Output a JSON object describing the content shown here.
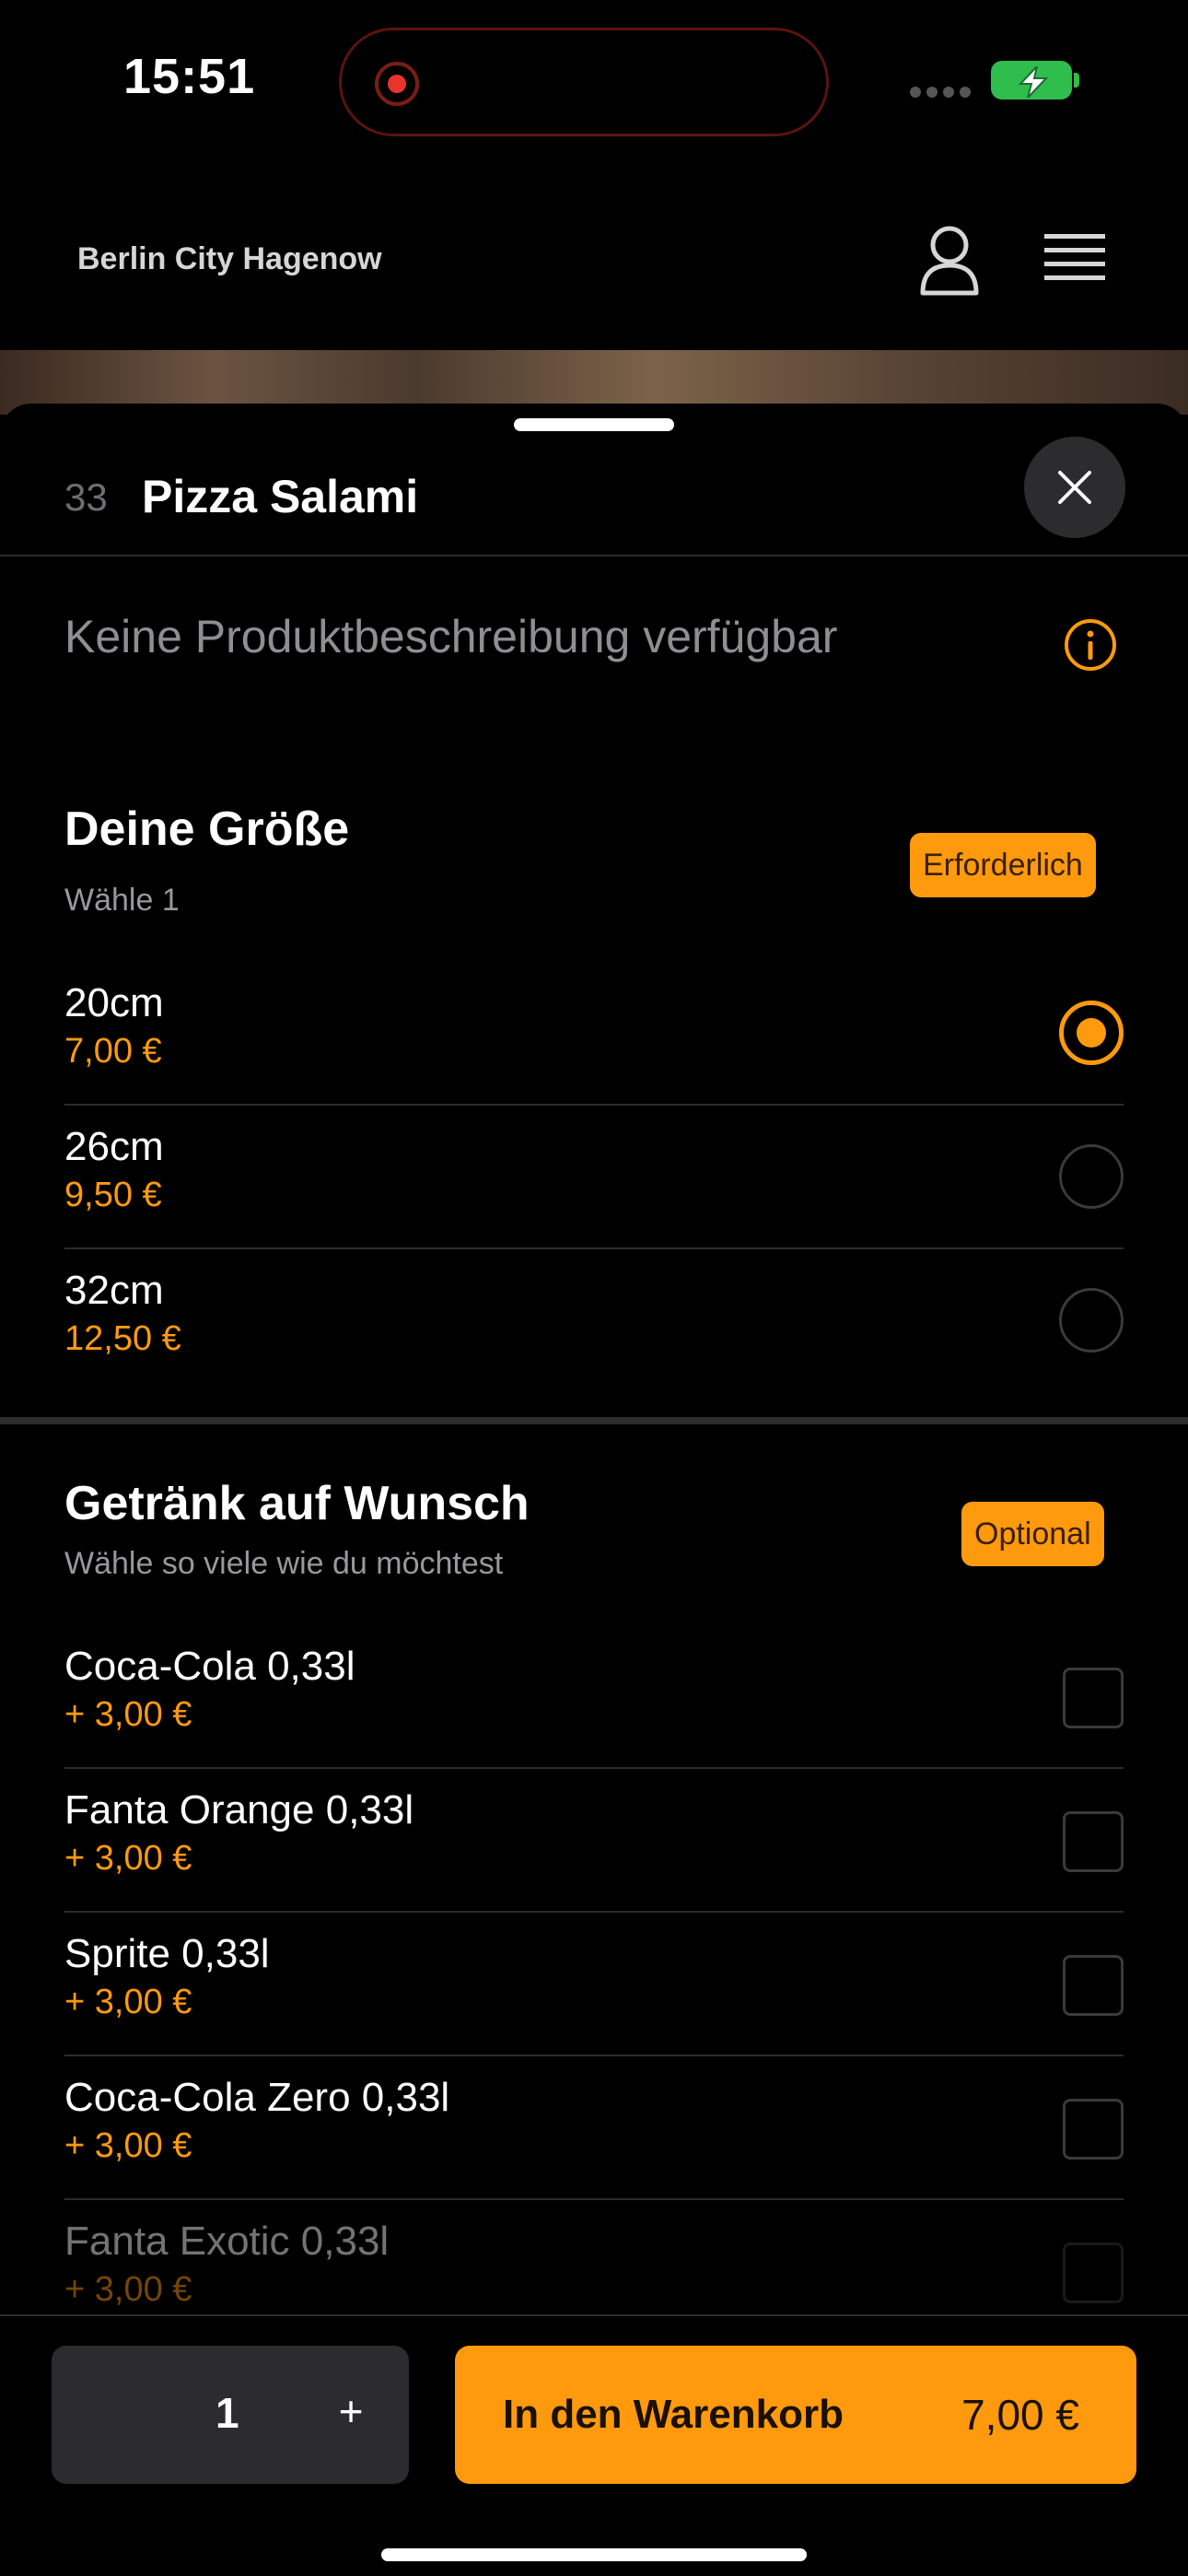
{
  "status_bar": {
    "time": "15:51"
  },
  "header": {
    "restaurant_name": "Berlin City Hagenow"
  },
  "product": {
    "number": "33",
    "title": "Pizza Salami",
    "description": "Keine Produktbeschreibung verfügbar"
  },
  "size_group": {
    "title": "Deine Größe",
    "subtitle": "Wähle 1",
    "badge": "Erforderlich",
    "options": [
      {
        "name": "20cm",
        "price": "7,00 €",
        "selected": true
      },
      {
        "name": "26cm",
        "price": "9,50 €",
        "selected": false
      },
      {
        "name": "32cm",
        "price": "12,50 €",
        "selected": false
      }
    ]
  },
  "drink_group": {
    "title": "Getränk auf Wunsch",
    "subtitle": "Wähle so viele wie du möchtest",
    "badge": "Optional",
    "options": [
      {
        "name": "Coca-Cola 0,33l",
        "price": "+ 3,00 €"
      },
      {
        "name": "Fanta Orange 0,33l",
        "price": "+ 3,00 €"
      },
      {
        "name": "Sprite 0,33l",
        "price": "+ 3,00 €"
      },
      {
        "name": "Coca-Cola Zero 0,33l",
        "price": "+ 3,00 €"
      },
      {
        "name": "Fanta Exotic 0,33l",
        "price": "+ 3,00 €"
      }
    ]
  },
  "footer": {
    "quantity": "1",
    "plus_label": "+",
    "cart_label": "In den Warenkorb",
    "cart_price": "7,00 €"
  },
  "colors": {
    "accent": "#ff9a0e",
    "background": "#000000",
    "surface": "#2c2c2e"
  },
  "icons": [
    "record-icon",
    "battery-charging-icon",
    "user-icon",
    "hamburger-menu-icon",
    "close-icon",
    "info-icon"
  ]
}
